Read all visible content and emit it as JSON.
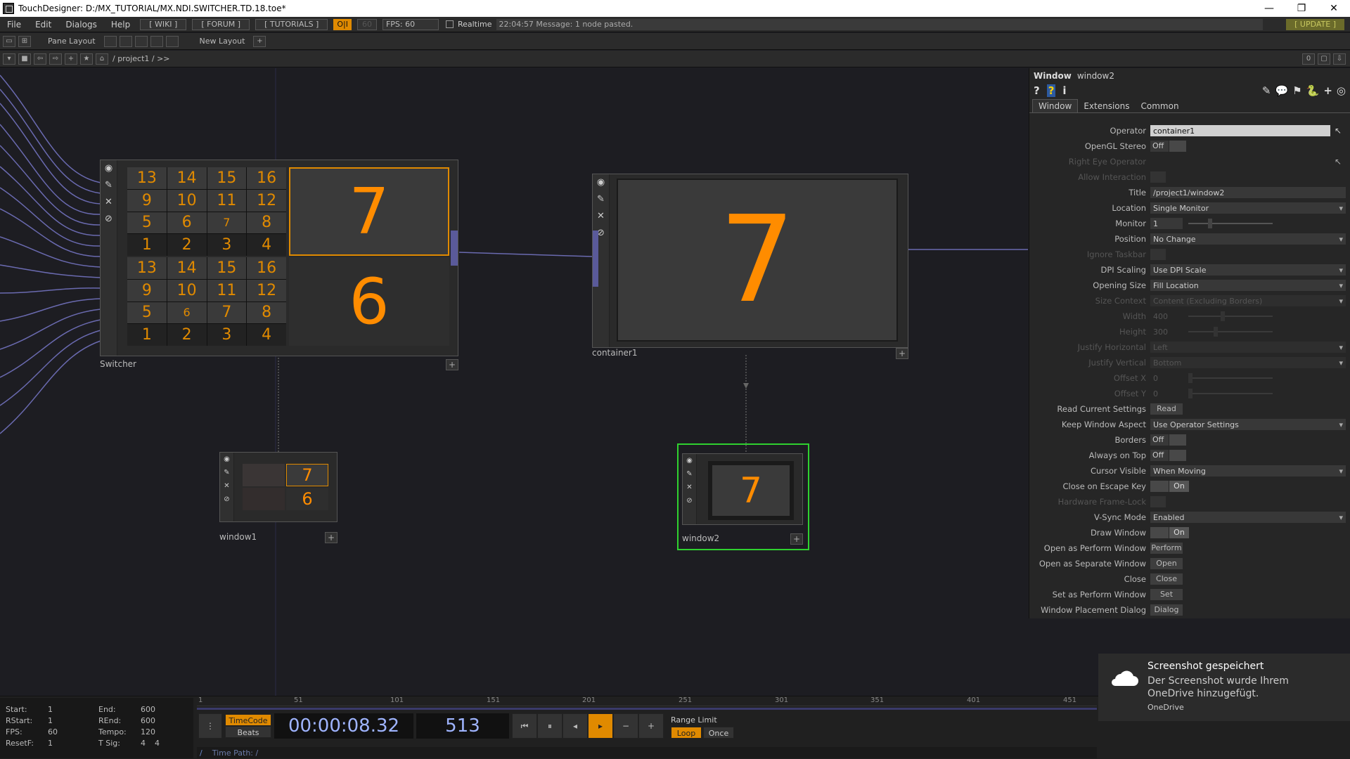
{
  "window": {
    "title": "TouchDesigner: D:/MX_TUTORIAL/MX.NDI.SWITCHER.TD.18.toe*"
  },
  "menu": {
    "items": [
      "File",
      "Edit",
      "Dialogs",
      "Help"
    ],
    "wiki": "[ WIKI ]",
    "forum": "[ FORUM ]",
    "tutorials": "[ TUTORIALS ]",
    "oi": "O|I",
    "fps_cap": "60",
    "fps": "FPS: 60",
    "realtime": "Realtime",
    "message": "22:04:57 Message: 1 node pasted.",
    "update": "[ UPDATE ]"
  },
  "toolbar": {
    "pane_layout": "Pane Layout",
    "new_layout": "New Layout",
    "path": "/ project1 / >>",
    "zero": "0"
  },
  "nodes": {
    "switcher": {
      "label": "Switcher",
      "grid_a": [
        "13",
        "14",
        "15",
        "16",
        "9",
        "10",
        "11",
        "12",
        "5",
        "6",
        "7",
        "8",
        "1",
        "2",
        "3",
        "4"
      ],
      "grid_b": [
        "13",
        "14",
        "15",
        "16",
        "9",
        "10",
        "11",
        "12",
        "5",
        "6",
        "7",
        "8",
        "1",
        "2",
        "3",
        "4"
      ],
      "top": "7",
      "bottom": "6"
    },
    "container1": {
      "label": "container1",
      "value": "7"
    },
    "window1": {
      "label": "window1",
      "top": "7",
      "bottom": "6"
    },
    "window2": {
      "label": "window2",
      "value": "7"
    }
  },
  "panel": {
    "type": "Window",
    "name": "window2",
    "tabs": [
      "Window",
      "Extensions",
      "Common"
    ],
    "params": {
      "operator": {
        "label": "Operator",
        "value": "container1"
      },
      "opengl": {
        "label": "OpenGL Stereo",
        "value": "Off"
      },
      "righteye": {
        "label": "Right Eye Operator"
      },
      "allowint": {
        "label": "Allow Interaction"
      },
      "title": {
        "label": "Title",
        "value": "/project1/window2"
      },
      "location": {
        "label": "Location",
        "value": "Single Monitor"
      },
      "monitor": {
        "label": "Monitor",
        "value": "1"
      },
      "position": {
        "label": "Position",
        "value": "No Change"
      },
      "ignoretask": {
        "label": "Ignore Taskbar"
      },
      "dpi": {
        "label": "DPI Scaling",
        "value": "Use DPI Scale"
      },
      "opensize": {
        "label": "Opening Size",
        "value": "Fill Location"
      },
      "sizectx": {
        "label": "Size Context",
        "value": "Content (Excluding Borders)"
      },
      "width": {
        "label": "Width",
        "value": "400"
      },
      "height": {
        "label": "Height",
        "value": "300"
      },
      "justh": {
        "label": "Justify Horizontal",
        "value": "Left"
      },
      "justv": {
        "label": "Justify Vertical",
        "value": "Bottom"
      },
      "offx": {
        "label": "Offset X",
        "value": "0"
      },
      "offy": {
        "label": "Offset Y",
        "value": "0"
      },
      "readcur": {
        "label": "Read Current Settings",
        "value": "Read"
      },
      "keepaspect": {
        "label": "Keep Window Aspect",
        "value": "Use Operator Settings"
      },
      "borders": {
        "label": "Borders",
        "value": "Off"
      },
      "ontop": {
        "label": "Always on Top",
        "value": "Off"
      },
      "cursor": {
        "label": "Cursor Visible",
        "value": "When Moving"
      },
      "escape": {
        "label": "Close on Escape Key",
        "value": "On"
      },
      "hwlock": {
        "label": "Hardware Frame-Lock"
      },
      "vsync": {
        "label": "V-Sync Mode",
        "value": "Enabled"
      },
      "draw": {
        "label": "Draw Window",
        "value": "On"
      },
      "perform": {
        "label": "Open as Perform Window",
        "value": "Perform"
      },
      "separate": {
        "label": "Open as Separate Window",
        "value": "Open"
      },
      "close": {
        "label": "Close",
        "value": "Close"
      },
      "setperform": {
        "label": "Set as Perform Window",
        "value": "Set"
      },
      "placement": {
        "label": "Window Placement Dialog",
        "value": "Dialog"
      }
    }
  },
  "timeline": {
    "start_label": "Start:",
    "start": "1",
    "end_label": "End:",
    "end": "600",
    "rstart_label": "RStart:",
    "rstart": "1",
    "rend_label": "REnd:",
    "rend": "600",
    "fps_label": "FPS:",
    "fps": "60",
    "tempo_label": "Tempo:",
    "tempo": "120",
    "resetf_label": "ResetF:",
    "resetf": "1",
    "tsig_label": "T Sig:",
    "tsig_a": "4",
    "tsig_b": "4",
    "ruler": [
      "1",
      "51",
      "101",
      "151",
      "201",
      "251",
      "301",
      "351",
      "401",
      "451"
    ],
    "timecode": "TimeCode",
    "beats": "Beats",
    "time": "00:00:08.32",
    "frame": "513",
    "range_limit": "Range Limit",
    "loop": "Loop",
    "once": "Once",
    "timepath": "Time Path: /"
  },
  "toast": {
    "title": "Screenshot gespeichert",
    "body": "Der Screenshot wurde Ihrem OneDrive hinzugefügt.",
    "source": "OneDrive"
  },
  "colors": {
    "accent": "#e08a00",
    "number": "#ff8c00",
    "selected": "#2fd12f",
    "wire": "#6a6ab0"
  }
}
